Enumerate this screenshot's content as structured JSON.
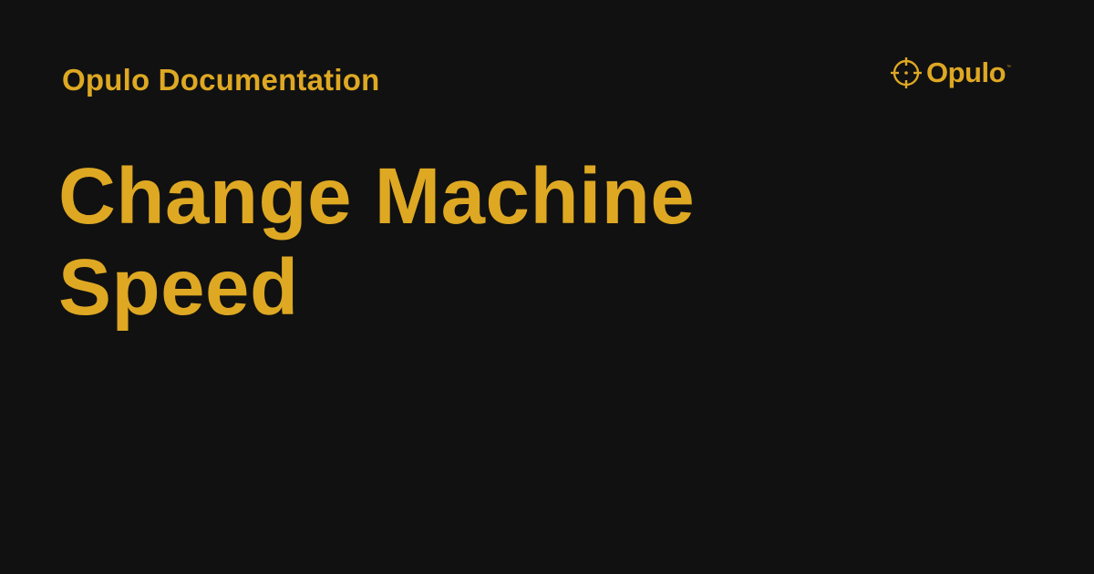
{
  "header": {
    "site_name": "Opulo Documentation"
  },
  "logo": {
    "wordmark": "Opulo",
    "trademark": "™",
    "icon": "crosshair-icon"
  },
  "page": {
    "title_line_1": "Change Machine",
    "title_line_2": "Speed"
  },
  "colors": {
    "background": "#111111",
    "accent": "#dea823"
  }
}
